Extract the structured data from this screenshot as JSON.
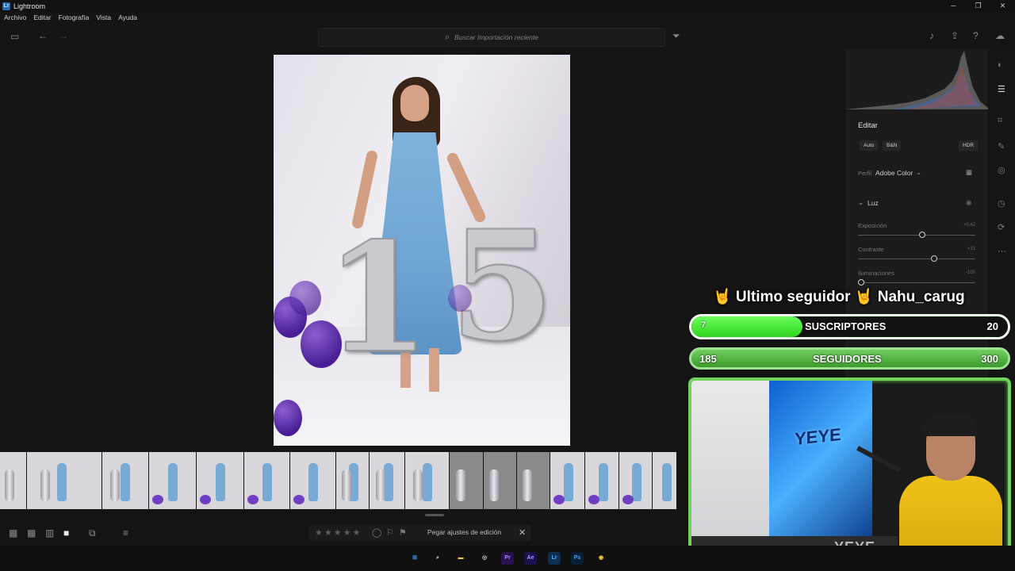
{
  "window": {
    "title": "Lightroom",
    "controls": [
      "─",
      "❐",
      "✕"
    ]
  },
  "menu": [
    "Archivo",
    "Editar",
    "Fotografía",
    "Vista",
    "Ayuda"
  ],
  "toolbar": {
    "search_placeholder": "Buscar Importación reciente"
  },
  "edit_panel": {
    "title": "Editar",
    "buttons": {
      "auto": "Auto",
      "bw": "B&N",
      "hdr": "HDR"
    },
    "profile_label": "Perfil",
    "profile_value": "Adobe Color",
    "section": "Luz",
    "sliders": [
      {
        "label": "Exposición",
        "value": "+0,42",
        "level": 0.55
      },
      {
        "label": "Contraste",
        "value": "+31",
        "level": 0.66
      },
      {
        "label": "Iluminaciones",
        "value": "-100",
        "level": 0.0
      }
    ]
  },
  "bottom_bar": {
    "paste_label": "Pegar ajustes de edición",
    "stars": "★★★★★"
  },
  "overlay": {
    "follower_line": "🤘 Ultimo seguidor 🤘 Nahu_carug",
    "subs": {
      "label": "SUSCRIPTORES",
      "current": "7",
      "goal": "20",
      "progress": 0.35
    },
    "followers": {
      "label": "SEGUIDORES",
      "current": "185",
      "goal": "300",
      "progress": 0.62
    },
    "cam_sign": "YEYE",
    "cam_brand": "YEYE"
  },
  "taskbar": {
    "apps": [
      {
        "name": "windows-start",
        "label": "⊞",
        "color": "#3aa0ff"
      },
      {
        "name": "search",
        "label": "⌕",
        "color": "#dcdcdc"
      },
      {
        "name": "file-explorer",
        "label": "▬",
        "color": "#f5c542"
      },
      {
        "name": "browser-beta",
        "label": "◎",
        "color": "#cccccc"
      },
      {
        "name": "premiere",
        "label": "Pr",
        "color": "#9999ff"
      },
      {
        "name": "after-effects",
        "label": "Ae",
        "color": "#9999ff"
      },
      {
        "name": "lightroom",
        "label": "Lr",
        "color": "#4fb0ff"
      },
      {
        "name": "photoshop",
        "label": "Ps",
        "color": "#31a8ff"
      },
      {
        "name": "chrome",
        "label": "◉",
        "color": "#ffcc33"
      }
    ]
  },
  "colors": {
    "accent": "#72d35d",
    "bg": "#141414",
    "panel": "#1b1b1b"
  }
}
